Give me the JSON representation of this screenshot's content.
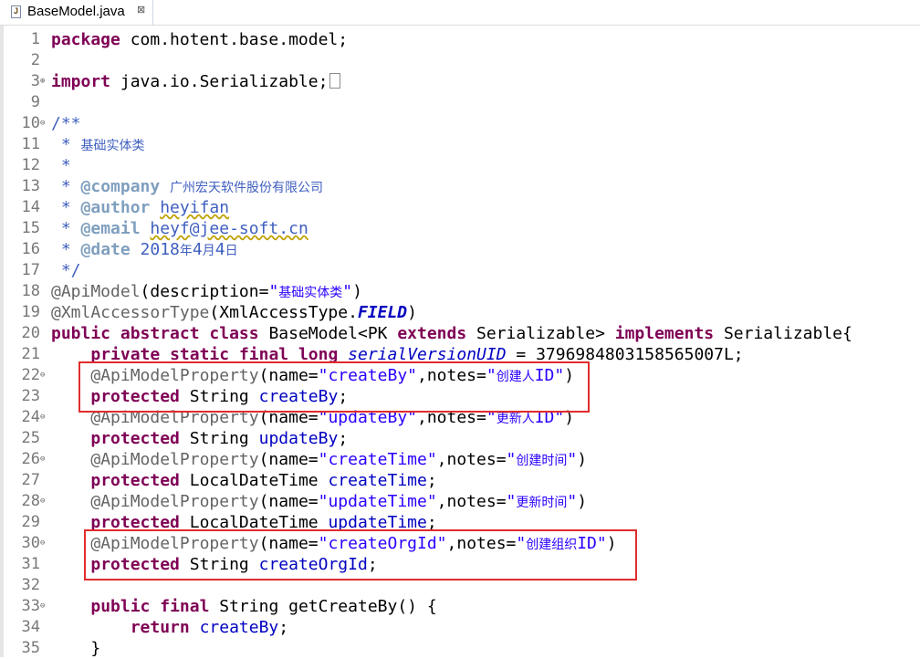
{
  "tab": {
    "title": "BaseModel.java",
    "close": "⊠"
  },
  "lines": [
    {
      "n": "1",
      "t": "package com.hotent.base.model;"
    },
    {
      "n": "2",
      "t": ""
    },
    {
      "n": "3",
      "t": "import java.io.Serializable;"
    },
    {
      "n": "9",
      "t": ""
    },
    {
      "n": "10",
      "t": "/**"
    },
    {
      "n": "11",
      "t": " * 基础实体类"
    },
    {
      "n": "12",
      "t": " *"
    },
    {
      "n": "13",
      "t": " * @company 广州宏天软件股份有限公司"
    },
    {
      "n": "14",
      "t": " * @author heyifan"
    },
    {
      "n": "15",
      "t": " * @email heyf@jee-soft.cn"
    },
    {
      "n": "16",
      "t": " * @date 2018年4月4日"
    },
    {
      "n": "17",
      "t": " */"
    },
    {
      "n": "18",
      "t": "@ApiModel(description=\"基础实体类\")"
    },
    {
      "n": "19",
      "t": "@XmlAccessorType(XmlAccessType.FIELD)"
    },
    {
      "n": "20",
      "t": "public abstract class BaseModel<PK extends Serializable> implements Serializable{"
    },
    {
      "n": "21",
      "t": "    private static final long serialVersionUID = 3796984803158565007L;"
    },
    {
      "n": "22",
      "t": "    @ApiModelProperty(name=\"createBy\",notes=\"创建人ID\")"
    },
    {
      "n": "23",
      "t": "    protected String createBy;"
    },
    {
      "n": "24",
      "t": "    @ApiModelProperty(name=\"updateBy\",notes=\"更新人ID\")"
    },
    {
      "n": "25",
      "t": "    protected String updateBy;"
    },
    {
      "n": "26",
      "t": "    @ApiModelProperty(name=\"createTime\",notes=\"创建时间\")"
    },
    {
      "n": "27",
      "t": "    protected LocalDateTime createTime;"
    },
    {
      "n": "28",
      "t": "    @ApiModelProperty(name=\"updateTime\",notes=\"更新时间\")"
    },
    {
      "n": "29",
      "t": "    protected LocalDateTime updateTime;"
    },
    {
      "n": "30",
      "t": "    @ApiModelProperty(name=\"createOrgId\",notes=\"创建组织ID\")"
    },
    {
      "n": "31",
      "t": "    protected String createOrgId;"
    },
    {
      "n": "32",
      "t": ""
    },
    {
      "n": "33",
      "t": "    public final String getCreateBy() {"
    },
    {
      "n": "34",
      "t": "        return createBy;"
    },
    {
      "n": "35",
      "t": "    }"
    }
  ],
  "fold_lines": [
    "3",
    "10",
    "22",
    "24",
    "26",
    "28",
    "30",
    "33"
  ],
  "collapsed_fold_lines": [
    "3"
  ],
  "colors": {
    "keyword": "#7f0055",
    "string": "#2a00ff",
    "comment": "#3f5fbf",
    "javadoc_tag": "#7f9fbf",
    "annotation": "#646464",
    "field": "#0000c0",
    "highlight_box": "#e02c2c"
  },
  "highlight_boxes": [
    {
      "from_line": "22",
      "to_line": "23"
    },
    {
      "from_line": "30",
      "to_line": "31"
    }
  ]
}
